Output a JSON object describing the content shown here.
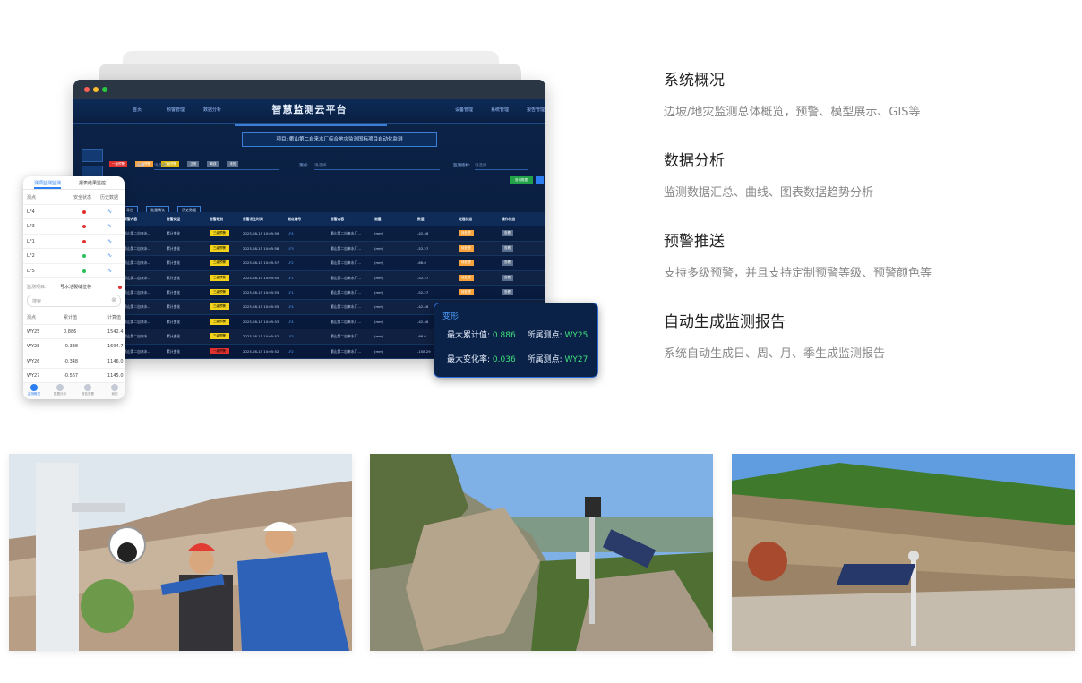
{
  "platform": {
    "title": "智慧监测云平台",
    "nav_left": [
      "首页",
      "预警管理",
      "数据分析"
    ],
    "nav_right": [
      "设备管理",
      "系统管理",
      "报告管理"
    ],
    "project": "项目: 衢山第二自来水厂综合地灾监测国标项目自动化监测",
    "rail": [
      "监测项目"
    ],
    "legend": [
      {
        "label": "一级预警",
        "color": "#e0312f"
      },
      {
        "label": "二级预警",
        "color": "#f7a23a"
      },
      {
        "label": "三级预警",
        "color": "#f2d21a"
      },
      {
        "label": "正常",
        "color": "#596e8c"
      },
      {
        "label": "离线",
        "color": "#596e8c"
      },
      {
        "label": "未知",
        "color": "#596e8c"
      }
    ],
    "filters": {
      "f1_label": "测站:",
      "f1_value": "请选择",
      "f2_label": "测点:",
      "f2_value": "请选择",
      "f3_label": "监测指标:",
      "f3_value": "请选择"
    },
    "search_label": "查询数据",
    "actions": [
      "导出",
      "批量确认",
      "历史数据"
    ],
    "columns": [
      "预警内容",
      "告警类型",
      "告警级别",
      "告警发生时间",
      "测点编号",
      "告警内容",
      "测量",
      "数值",
      "处理状态",
      "操作状态"
    ],
    "rows": [
      {
        "content": "衢山第二自来水...",
        "type": "累计变化",
        "level": "三级预警",
        "level_color": "#f2d21a",
        "time": "2023-08-15 10:05:59",
        "point": "LF4",
        "desc": "衢山第二自来水厂...",
        "unit": "(mm)",
        "value": "-42.46",
        "state": "待处理",
        "op": "查看"
      },
      {
        "content": "衢山第二自来水...",
        "type": "累计变化",
        "level": "三级预警",
        "level_color": "#f2d21a",
        "time": "2023-08-15 10:05:58",
        "point": "LF3",
        "desc": "衢山第二自来水厂...",
        "unit": "(mm)",
        "value": "-52.27",
        "state": "待处理",
        "op": "查看"
      },
      {
        "content": "衢山第二自来水...",
        "type": "累计变化",
        "level": "三级预警",
        "level_color": "#f2d21a",
        "time": "2023-08-15 10:05:57",
        "point": "LF2",
        "desc": "衢山第二自来水厂...",
        "unit": "(mm)",
        "value": "-66.6",
        "state": "待处理",
        "op": "查看"
      },
      {
        "content": "衢山第二自来水...",
        "type": "累计变化",
        "level": "三级预警",
        "level_color": "#f2d21a",
        "time": "2023-08-15 10:05:55",
        "point": "LF1",
        "desc": "衢山第二自来水厂...",
        "unit": "(mm)",
        "value": "-52.27",
        "state": "待处理",
        "op": "查看"
      },
      {
        "content": "衢山第二自来水...",
        "type": "累计变化",
        "level": "三级预警",
        "level_color": "#f2d21a",
        "time": "2023-08-15 10:05:55",
        "point": "LF1",
        "desc": "衢山第二自来水厂...",
        "unit": "(mm)",
        "value": "-52.27",
        "state": "待处理",
        "op": "查看"
      },
      {
        "content": "衢山第二自来水...",
        "type": "累计变化",
        "level": "三级预警",
        "level_color": "#f2d21a",
        "time": "2023-08-15 10:05:55",
        "point": "LF4",
        "desc": "衢山第二自来水厂...",
        "unit": "(mm)",
        "value": "-42.46",
        "state": "待处理",
        "op": "查看"
      },
      {
        "content": "衢山第二自来水...",
        "type": "累计变化",
        "level": "三级预警",
        "level_color": "#f2d21a",
        "time": "2023-08-15 10:05:53",
        "point": "LF4",
        "desc": "衢山第二自来水厂...",
        "unit": "(mm)",
        "value": "-42.46",
        "state": "待处理",
        "op": "查看"
      },
      {
        "content": "衢山第二自来水...",
        "type": "累计变化",
        "level": "三级预警",
        "level_color": "#f2d21a",
        "time": "2023-08-15 10:05:52",
        "point": "LF3",
        "desc": "衢山第二自来水厂...",
        "unit": "(mm)",
        "value": "-66.6",
        "state": "待处理",
        "op": "查看"
      },
      {
        "content": "衢山第二自来水...",
        "type": "累计变化",
        "level": "一级预警",
        "level_color": "#e0312f",
        "time": "2023-08-15 10:05:52",
        "point": "LF2",
        "desc": "衢山第二自来水厂...",
        "unit": "(mm)",
        "value": "-158.29",
        "state": "待处理",
        "op": "查看"
      }
    ]
  },
  "overlay": {
    "title": "变形",
    "row1_label": "最大累计值:",
    "row1_value": "0.886",
    "row1_point_label": "所属测点:",
    "row1_point": "WY25",
    "row2_label": "最大变化率:",
    "row2_value": "0.036",
    "row2_point_label": "所属测点:",
    "row2_point": "WY27"
  },
  "phone": {
    "tabs": [
      "测项监测监测",
      "报表结果监控"
    ],
    "headers": [
      "测点",
      "安全状态",
      "历史数据"
    ],
    "points": [
      {
        "name": "LF4",
        "dot": "#e0312f"
      },
      {
        "name": "LF3",
        "dot": "#e0312f"
      },
      {
        "name": "LF1",
        "dot": "#e0312f"
      },
      {
        "name": "LF2",
        "dot": "#2cbf5a"
      },
      {
        "name": "LF5",
        "dot": "#2cbf5a"
      }
    ],
    "project_label": "监测项目:",
    "project_value": "一号水池裂缝位移",
    "search_placeholder": "搜索",
    "headers2": [
      "测点",
      "累计值",
      "计算值"
    ],
    "values": [
      {
        "name": "WY25",
        "acc": "0.886",
        "calc": "1542.4"
      },
      {
        "name": "WY28",
        "acc": "-0.338",
        "calc": "1694.7"
      },
      {
        "name": "WY26",
        "acc": "-0.348",
        "calc": "1146.0"
      },
      {
        "name": "WY27",
        "acc": "-0.567",
        "calc": "1145.0"
      }
    ],
    "bottom_nav": [
      "监测概况",
      "数据分析",
      "报告查看",
      "我的"
    ]
  },
  "features": [
    {
      "title": "系统概况",
      "desc": "边坡/地灾监测总体概览，预警、模型展示、GIS等"
    },
    {
      "title": "数据分析",
      "desc": "监测数据汇总、曲线、图表数据趋势分析"
    },
    {
      "title": "预警推送",
      "desc": "支持多级预警，并且支持定制预警等级、预警颜色等"
    },
    {
      "title": "自动生成监测报告",
      "desc": "系统自动生成日、周、月、季生成监测报告"
    }
  ],
  "photos": [
    {
      "subject": "workers-installing-camera"
    },
    {
      "subject": "monitoring-station-on-cliff"
    },
    {
      "subject": "solar-monitoring-pole-quarry"
    }
  ]
}
